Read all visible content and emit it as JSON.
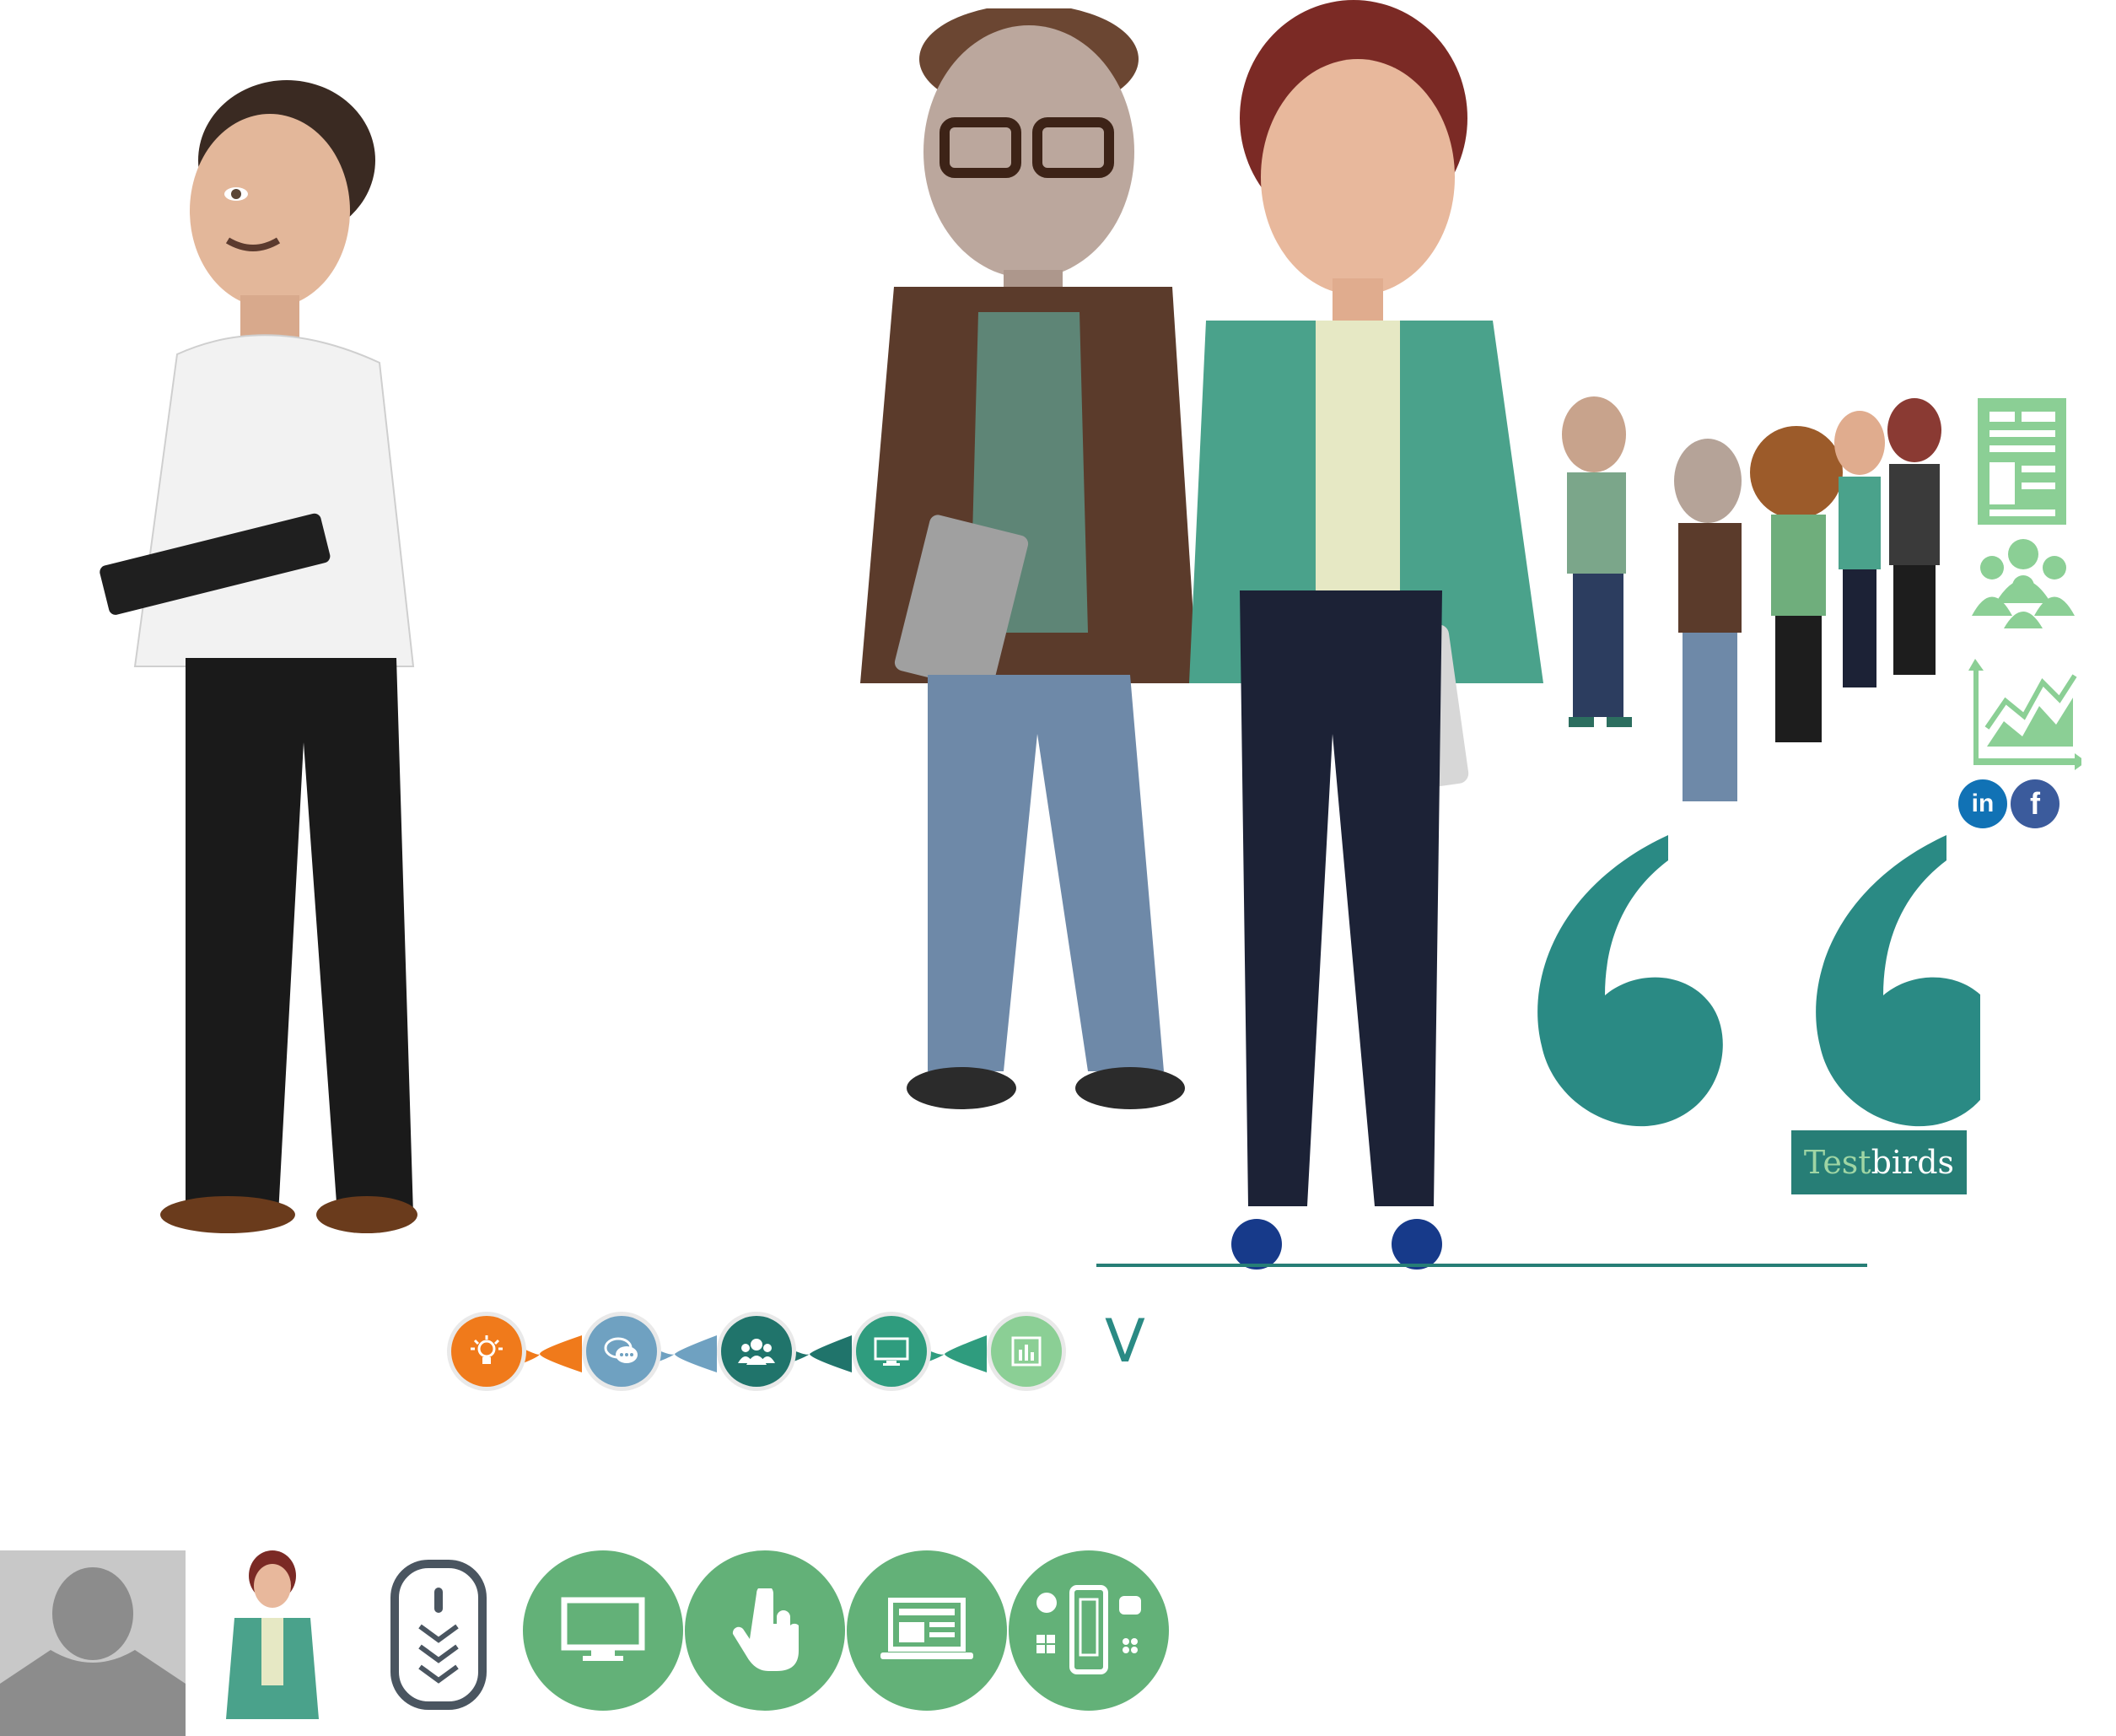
{
  "brand": {
    "logo_text_part1": "Test",
    "logo_text_part2": "birds"
  },
  "colors": {
    "teal": "#277e76",
    "quote_teal": "#2a8a84",
    "green": "#63b178",
    "light_green": "#8bcf95",
    "orange": "#f07a1b",
    "steel_blue": "#6fa1c1",
    "dark_teal": "#20746b",
    "linkedin": "#1172b5",
    "facebook": "#3b5b9c"
  },
  "icons": {
    "side": [
      "document-icon",
      "group-icon",
      "growth-chart-icon"
    ],
    "social": [
      "linkedin-icon",
      "facebook-icon"
    ],
    "progress": [
      "lightbulb-icon",
      "chat-icon",
      "group-icon",
      "monitor-icon",
      "bar-chart-icon"
    ],
    "bottom": [
      "avatar-placeholder-icon",
      "scroll-down-icon",
      "desktop-icon",
      "touch-icon",
      "laptop-icon",
      "devices-icon"
    ]
  },
  "chevron_label": "V",
  "social": {
    "linkedin": "in",
    "facebook": "f"
  }
}
